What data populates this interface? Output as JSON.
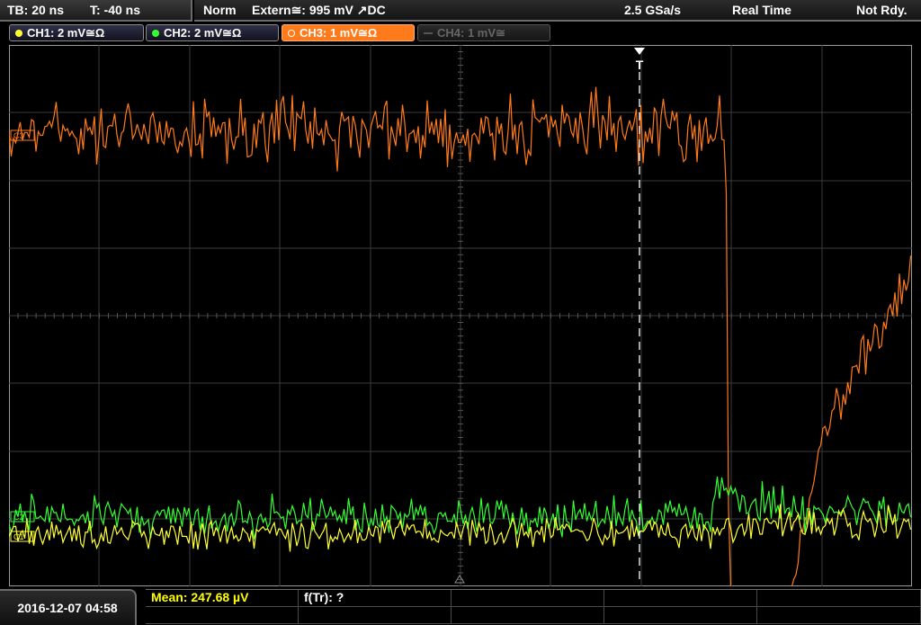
{
  "status": {
    "timebase": "TB: 20 ns",
    "trigger_offset": "T: -40 ns",
    "mode": "Norm",
    "trigger_source": "Extern≅: 995 mV ↗DC",
    "sample_rate": "2.5 GSa/s",
    "acq_mode": "Real Time",
    "state": "Not Rdy."
  },
  "channels": [
    {
      "label": "CH1: 2 mV≅Ω",
      "color": "#ffff33",
      "active": false,
      "enabled": true
    },
    {
      "label": "CH2: 2 mV≅Ω",
      "color": "#33ff33",
      "active": false,
      "enabled": true
    },
    {
      "label": "CH3: 1 mV≅Ω",
      "color": "#ff7a1a",
      "active": true,
      "enabled": true
    },
    {
      "label": "CH4: 1 mV≅",
      "color": "#666666",
      "active": false,
      "enabled": false
    }
  ],
  "markers": {
    "ch3": "C3",
    "ch2": "C2",
    "ch1": "C1",
    "trigger": "T"
  },
  "footer": {
    "datetime": "2016-12-07 04:58",
    "measurement_mean": "Mean: 247.68 µV",
    "measurement_ftr": "f(Tr): ?"
  },
  "colors": {
    "ch1": "#ffff33",
    "ch2": "#33ff33",
    "ch3": "#ff7a1a",
    "grid": "#3c3c3c",
    "accent_mean": "#ffff00"
  }
}
